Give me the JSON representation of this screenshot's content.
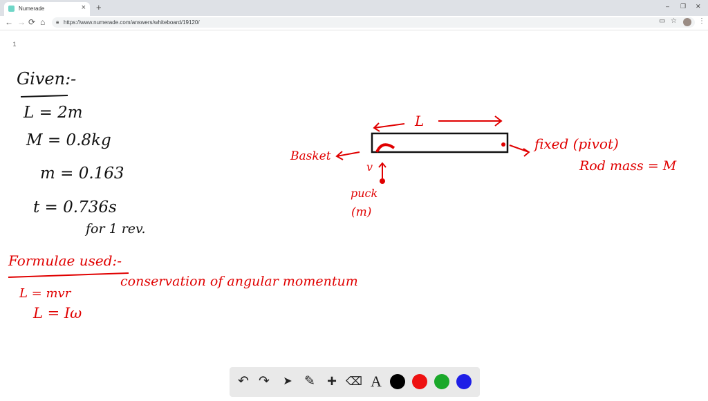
{
  "browser": {
    "tab_title": "Numerade",
    "tab_close": "×",
    "new_tab": "+",
    "url": "https://www.numerade.com/answers/whiteboard/19120/",
    "window_controls": [
      "–",
      "❐",
      "✕"
    ],
    "nav": {
      "back": "←",
      "forward": "→",
      "reload": "⟳",
      "home": "⌂"
    },
    "toolbar_icons": {
      "cast": "▭",
      "star": "☆",
      "menu": "⋮"
    }
  },
  "whiteboard": {
    "page_number": "1",
    "given": {
      "heading": "Given:-",
      "lines": [
        "L = 2m",
        "M = 0.8kg",
        "m = 0.163",
        "t = 0.736s",
        "for 1 rev."
      ]
    },
    "formulae": {
      "heading": "Formulae used:-",
      "lines": [
        "L = mvr",
        "L = Iω"
      ],
      "note": "conservation of angular momentum"
    },
    "diagram": {
      "length_label": "L",
      "basket": "Basket",
      "fixed": "fixed (pivot)",
      "rod_mass": "Rod mass = M",
      "velocity": "v",
      "puck": "puck",
      "puck_mass": "(m)"
    },
    "ink_colors": {
      "black": "#111111",
      "red": "#e00000"
    }
  },
  "tools": {
    "undo": "↶",
    "redo": "↷",
    "select": "➤",
    "pen": "✎",
    "add": "+",
    "eraser": "⌫",
    "text": "A",
    "colors": [
      "#000000",
      "#ee1111",
      "#1aa82a",
      "#1f1fe6"
    ]
  }
}
